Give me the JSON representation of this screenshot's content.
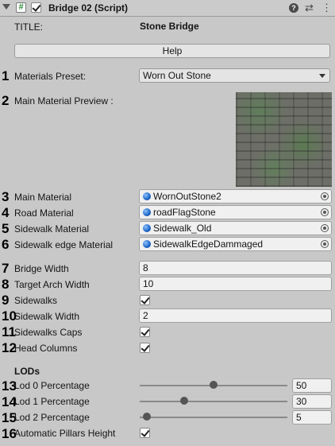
{
  "header": {
    "title": "Bridge 02 (Script)",
    "script_glyph": "#",
    "help_glyph": "?",
    "settings_glyph": "⇄",
    "more_glyph": "⋮"
  },
  "title_row": {
    "label": "TITLE:",
    "value": "Stone Bridge"
  },
  "help_button": "Help",
  "markers": [
    "1",
    "2",
    "3",
    "4",
    "5",
    "6",
    "7",
    "8",
    "9",
    "10",
    "11",
    "12",
    "13",
    "14",
    "15",
    "16"
  ],
  "materials_preset": {
    "label": "Materials Preset:",
    "value": "Worn Out Stone"
  },
  "preview": {
    "label": "Main Material Preview :"
  },
  "materials": [
    {
      "label": "Main Material",
      "value": "WornOutStone2"
    },
    {
      "label": "Road Material",
      "value": "roadFlagStone"
    },
    {
      "label": "Sidewalk Material",
      "value": "Sidewalk_Old"
    },
    {
      "label": "Sidewalk edge Material",
      "value": "SidewalkEdgeDammaged"
    }
  ],
  "bridge_width": {
    "label": "Bridge Width",
    "value": "8"
  },
  "target_arch_width": {
    "label": "Target Arch Width",
    "value": "10"
  },
  "sidewalks": {
    "label": "Sidewalks",
    "checked": true
  },
  "sidewalk_width": {
    "label": "Sidewalk Width",
    "value": "2"
  },
  "sidewalks_caps": {
    "label": "Sidewalks Caps",
    "checked": true
  },
  "head_columns": {
    "label": "Head Columns",
    "checked": true
  },
  "lods": {
    "heading": "LODs",
    "items": [
      {
        "label": "Lod 0 Percentage",
        "value": "50",
        "fraction": 0.5
      },
      {
        "label": "Lod 1 Percentage",
        "value": "30",
        "fraction": 0.3
      },
      {
        "label": "Lod 2 Percentage",
        "value": "5",
        "fraction": 0.05
      }
    ]
  },
  "automatic_pillars_height": {
    "label": "Automatic Pillars Height",
    "checked": true
  }
}
